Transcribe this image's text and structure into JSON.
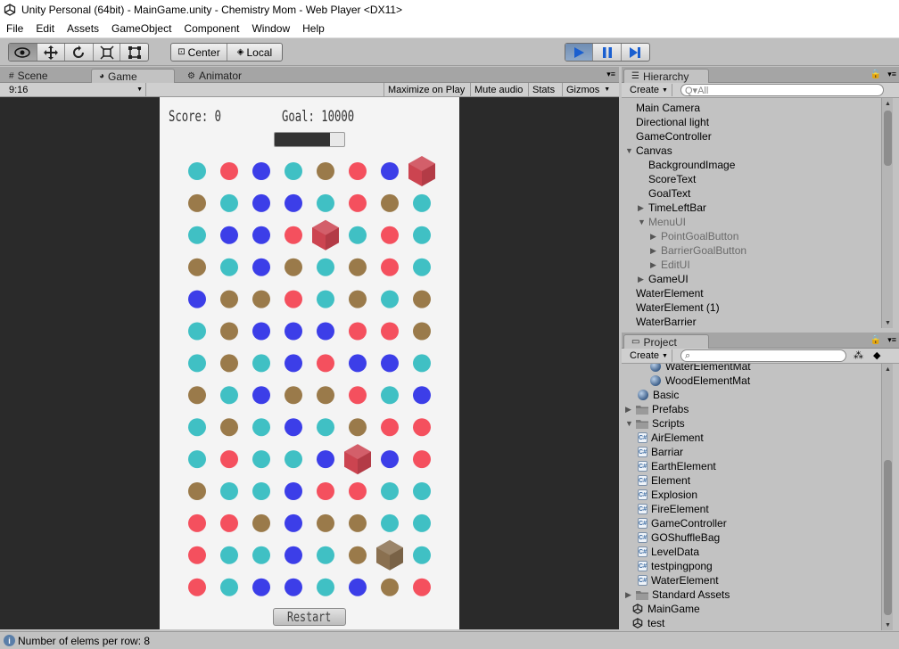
{
  "window": {
    "title": "Unity Personal (64bit) - MainGame.unity - Chemistry Mom - Web Player <DX11>"
  },
  "menu": [
    "File",
    "Edit",
    "Assets",
    "GameObject",
    "Component",
    "Window",
    "Help"
  ],
  "toolbar": {
    "tools": [
      "hand-icon",
      "move-icon",
      "rotate-icon",
      "scale-icon",
      "rect-icon"
    ],
    "pivot_label": "Center",
    "space_label": "Local",
    "play_state": "playing"
  },
  "tabs": {
    "scene": "Scene",
    "game": "Game",
    "animator": "Animator"
  },
  "gamebar": {
    "aspect": "9:16",
    "maximize": "Maximize on Play",
    "mute": "Mute audio",
    "stats": "Stats",
    "gizmos": "Gizmos"
  },
  "game": {
    "score_text": "Score: 0",
    "goal_text": "Goal: 10000",
    "time_left_fraction": 0.8,
    "restart_label": "Restart",
    "colors": {
      "cyan": "#40c0c4",
      "red": "#f4505e",
      "blue": "#3c3ee8",
      "brown": "#9a7a4a",
      "red_barrier": "#cc4450",
      "brown_barrier": "#8a7050"
    },
    "grid": [
      [
        "C",
        "R",
        "B",
        "C",
        "W",
        "R",
        "B",
        "RX"
      ],
      [
        "W",
        "C",
        "B",
        "B",
        "C",
        "R",
        "W",
        "C"
      ],
      [
        "C",
        "B",
        "B",
        "R",
        "RX",
        "C",
        "R",
        "C"
      ],
      [
        "W",
        "C",
        "B",
        "W",
        "C",
        "W",
        "R",
        "C"
      ],
      [
        "B",
        "W",
        "W",
        "R",
        "C",
        "W",
        "C",
        "W"
      ],
      [
        "C",
        "W",
        "B",
        "B",
        "B",
        "R",
        "R",
        "W"
      ],
      [
        "C",
        "W",
        "C",
        "B",
        "R",
        "B",
        "B",
        "C"
      ],
      [
        "W",
        "C",
        "B",
        "W",
        "W",
        "R",
        "C",
        "B"
      ],
      [
        "C",
        "W",
        "C",
        "B",
        "C",
        "W",
        "R",
        "R"
      ],
      [
        "C",
        "R",
        "C",
        "C",
        "B",
        "RX",
        "B",
        "R"
      ],
      [
        "W",
        "C",
        "C",
        "B",
        "R",
        "R",
        "C",
        "C"
      ],
      [
        "R",
        "R",
        "W",
        "B",
        "W",
        "W",
        "C",
        "C"
      ],
      [
        "R",
        "C",
        "C",
        "B",
        "C",
        "W",
        "WX",
        "C"
      ],
      [
        "R",
        "C",
        "B",
        "B",
        "C",
        "B",
        "W",
        "R"
      ]
    ]
  },
  "hierarchy": {
    "tab_label": "Hierarchy",
    "create_label": "Create",
    "search_placeholder": "Q▾All",
    "items": [
      {
        "label": "Main Camera",
        "depth": 0,
        "fold": "",
        "dim": false
      },
      {
        "label": "Directional light",
        "depth": 0,
        "fold": "",
        "dim": false
      },
      {
        "label": "GameController",
        "depth": 0,
        "fold": "",
        "dim": false
      },
      {
        "label": "Canvas",
        "depth": 0,
        "fold": "open",
        "dim": false
      },
      {
        "label": "BackgroundImage",
        "depth": 1,
        "fold": "",
        "dim": false
      },
      {
        "label": "ScoreText",
        "depth": 1,
        "fold": "",
        "dim": false
      },
      {
        "label": "GoalText",
        "depth": 1,
        "fold": "",
        "dim": false
      },
      {
        "label": "TimeLeftBar",
        "depth": 1,
        "fold": "closed",
        "dim": false
      },
      {
        "label": "MenuUI",
        "depth": 1,
        "fold": "open",
        "dim": true
      },
      {
        "label": "PointGoalButton",
        "depth": 2,
        "fold": "closed",
        "dim": true
      },
      {
        "label": "BarrierGoalButton",
        "depth": 2,
        "fold": "closed",
        "dim": true
      },
      {
        "label": "EditUI",
        "depth": 2,
        "fold": "closed",
        "dim": true
      },
      {
        "label": "GameUI",
        "depth": 1,
        "fold": "closed",
        "dim": false
      },
      {
        "label": "WaterElement",
        "depth": 0,
        "fold": "",
        "dim": false
      },
      {
        "label": "WaterElement (1)",
        "depth": 0,
        "fold": "",
        "dim": false
      },
      {
        "label": "WaterBarrier",
        "depth": 0,
        "fold": "",
        "dim": false
      }
    ]
  },
  "project": {
    "tab_label": "Project",
    "create_label": "Create",
    "items": [
      {
        "label": "WaterElementMat",
        "kind": "material",
        "depth": 2,
        "fold": ""
      },
      {
        "label": "WoodElementMat",
        "kind": "material",
        "depth": 2,
        "fold": ""
      },
      {
        "label": "Basic",
        "kind": "material",
        "depth": 1,
        "fold": ""
      },
      {
        "label": "Prefabs",
        "kind": "folder",
        "depth": 0,
        "fold": "closed"
      },
      {
        "label": "Scripts",
        "kind": "folder",
        "depth": 0,
        "fold": "open"
      },
      {
        "label": "AirElement",
        "kind": "script",
        "depth": 1,
        "fold": ""
      },
      {
        "label": "Barriar",
        "kind": "script",
        "depth": 1,
        "fold": ""
      },
      {
        "label": "EarthElement",
        "kind": "script",
        "depth": 1,
        "fold": ""
      },
      {
        "label": "Element",
        "kind": "script",
        "depth": 1,
        "fold": ""
      },
      {
        "label": "Explosion",
        "kind": "script",
        "depth": 1,
        "fold": ""
      },
      {
        "label": "FireElement",
        "kind": "script",
        "depth": 1,
        "fold": ""
      },
      {
        "label": "GameController",
        "kind": "script",
        "depth": 1,
        "fold": ""
      },
      {
        "label": "GOShuffleBag",
        "kind": "script",
        "depth": 1,
        "fold": ""
      },
      {
        "label": "LevelData",
        "kind": "script",
        "depth": 1,
        "fold": ""
      },
      {
        "label": "testpingpong",
        "kind": "script",
        "depth": 1,
        "fold": ""
      },
      {
        "label": "WaterElement",
        "kind": "script",
        "depth": 1,
        "fold": ""
      },
      {
        "label": "Standard Assets",
        "kind": "folder",
        "depth": 0,
        "fold": "closed"
      },
      {
        "label": "MainGame",
        "kind": "scene",
        "depth": 0,
        "fold": ""
      },
      {
        "label": "test",
        "kind": "scene",
        "depth": 0,
        "fold": ""
      }
    ]
  },
  "status": {
    "text": "Number of elems per row: 8"
  }
}
